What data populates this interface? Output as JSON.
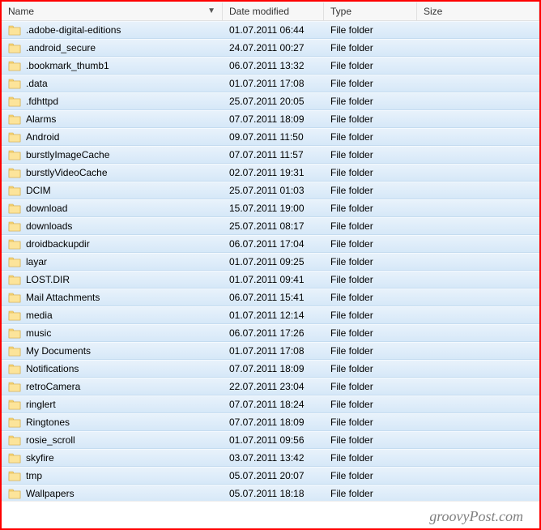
{
  "columns": {
    "name": "Name",
    "date": "Date modified",
    "type": "Type",
    "size": "Size"
  },
  "sort_indicator": "▼",
  "files": [
    {
      "name": ".adobe-digital-editions",
      "date": "01.07.2011 06:44",
      "type": "File folder"
    },
    {
      "name": ".android_secure",
      "date": "24.07.2011 00:27",
      "type": "File folder"
    },
    {
      "name": ".bookmark_thumb1",
      "date": "06.07.2011 13:32",
      "type": "File folder"
    },
    {
      "name": ".data",
      "date": "01.07.2011 17:08",
      "type": "File folder"
    },
    {
      "name": ".fdhttpd",
      "date": "25.07.2011 20:05",
      "type": "File folder"
    },
    {
      "name": "Alarms",
      "date": "07.07.2011 18:09",
      "type": "File folder"
    },
    {
      "name": "Android",
      "date": "09.07.2011 11:50",
      "type": "File folder"
    },
    {
      "name": "burstlyImageCache",
      "date": "07.07.2011 11:57",
      "type": "File folder"
    },
    {
      "name": "burstlyVideoCache",
      "date": "02.07.2011 19:31",
      "type": "File folder"
    },
    {
      "name": "DCIM",
      "date": "25.07.2011 01:03",
      "type": "File folder"
    },
    {
      "name": "download",
      "date": "15.07.2011 19:00",
      "type": "File folder"
    },
    {
      "name": "downloads",
      "date": "25.07.2011 08:17",
      "type": "File folder"
    },
    {
      "name": "droidbackupdir",
      "date": "06.07.2011 17:04",
      "type": "File folder"
    },
    {
      "name": "layar",
      "date": "01.07.2011 09:25",
      "type": "File folder"
    },
    {
      "name": "LOST.DIR",
      "date": "01.07.2011 09:41",
      "type": "File folder"
    },
    {
      "name": "Mail Attachments",
      "date": "06.07.2011 15:41",
      "type": "File folder"
    },
    {
      "name": "media",
      "date": "01.07.2011 12:14",
      "type": "File folder"
    },
    {
      "name": "music",
      "date": "06.07.2011 17:26",
      "type": "File folder"
    },
    {
      "name": "My Documents",
      "date": "01.07.2011 17:08",
      "type": "File folder"
    },
    {
      "name": "Notifications",
      "date": "07.07.2011 18:09",
      "type": "File folder"
    },
    {
      "name": "retroCamera",
      "date": "22.07.2011 23:04",
      "type": "File folder"
    },
    {
      "name": "ringlert",
      "date": "07.07.2011 18:24",
      "type": "File folder"
    },
    {
      "name": "Ringtones",
      "date": "07.07.2011 18:09",
      "type": "File folder"
    },
    {
      "name": "rosie_scroll",
      "date": "01.07.2011 09:56",
      "type": "File folder"
    },
    {
      "name": "skyfire",
      "date": "03.07.2011 13:42",
      "type": "File folder"
    },
    {
      "name": "tmp",
      "date": "05.07.2011 20:07",
      "type": "File folder"
    },
    {
      "name": "Wallpapers",
      "date": "05.07.2011 18:18",
      "type": "File folder"
    }
  ],
  "footer_text": "groovyPost.com"
}
